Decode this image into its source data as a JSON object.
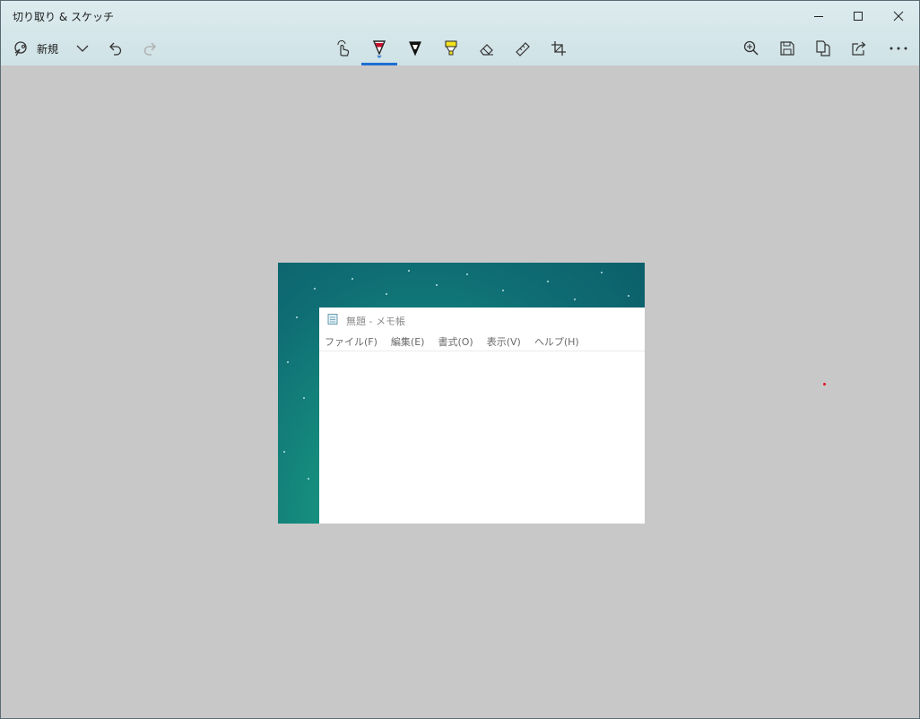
{
  "window": {
    "title": "切り取り & スケッチ",
    "controls": [
      "minimize-icon",
      "maximize-icon",
      "close-icon"
    ]
  },
  "toolbar": {
    "new_label": "新規",
    "left_tools": [
      "new-snip-icon",
      "chevron-down-icon",
      "undo-icon",
      "redo-icon"
    ],
    "center_tools": [
      "touch-writing-icon",
      "ballpoint-pen-icon",
      "pencil-icon",
      "highlighter-icon",
      "eraser-icon",
      "ruler-icon",
      "crop-icon"
    ],
    "active_tool": "ballpoint-pen-icon",
    "right_tools": [
      "zoom-in-icon",
      "save-icon",
      "copy-icon",
      "share-icon",
      "more-icon"
    ],
    "accent_color": "#1f6fd1",
    "pen_color": "#c8102e",
    "highlighter_color": "#f2e21b"
  },
  "capture": {
    "notepad_title": "無題 - メモ帳",
    "menu": [
      "ファイル(F)",
      "編集(E)",
      "書式(O)",
      "表示(V)",
      "ヘルプ(H)"
    ]
  }
}
